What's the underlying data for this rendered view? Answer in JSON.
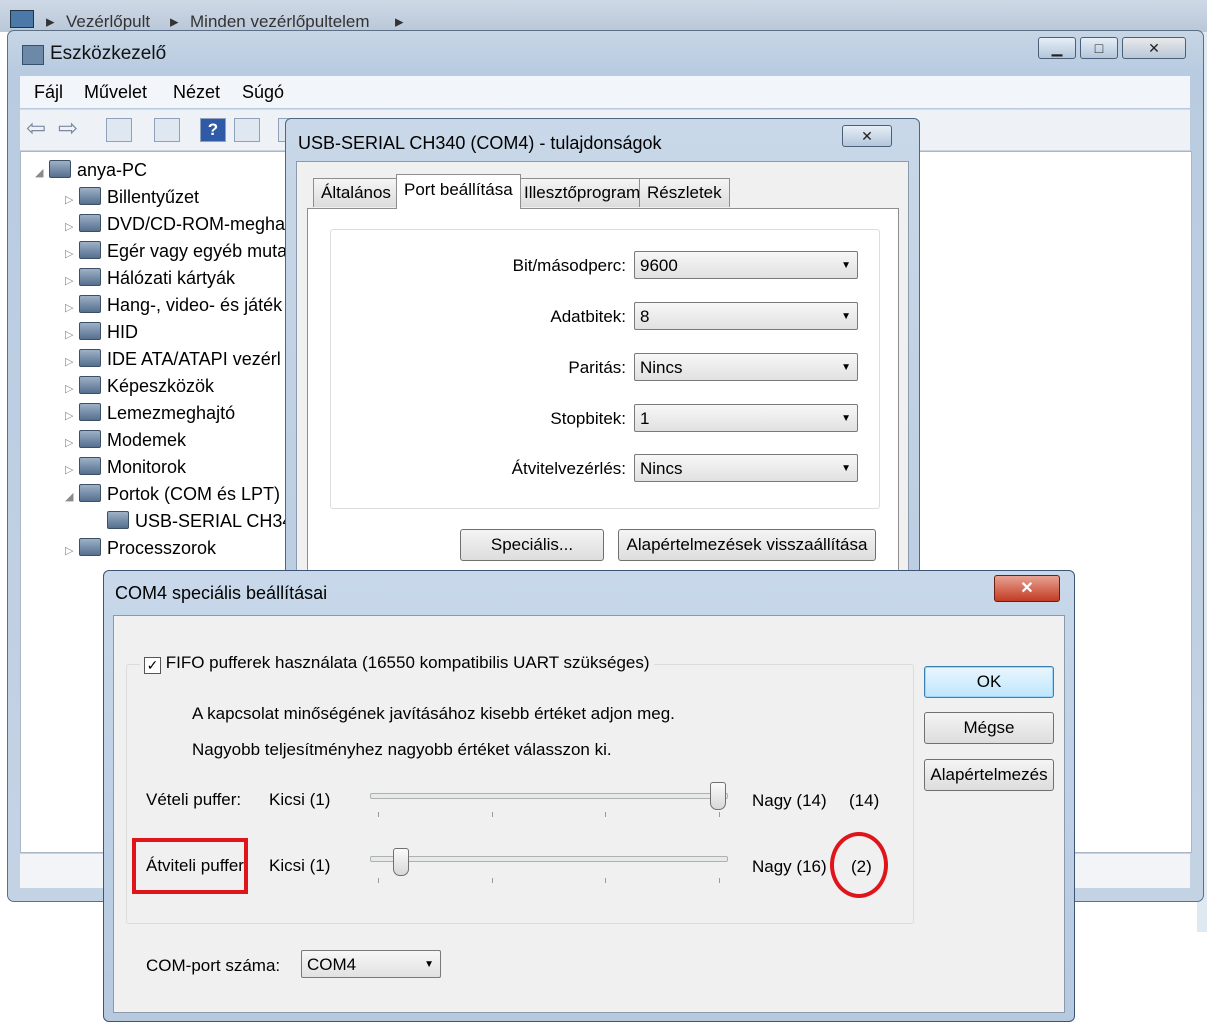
{
  "explorer": {
    "breadcrumb_1": "Vezérlőpult",
    "breadcrumb_2": "Minden vezérlőpultelem",
    "separator": "▸"
  },
  "device_manager": {
    "title": "Eszközkezelő",
    "caption": {
      "minimize": "▁",
      "maximize": "□",
      "close": "✕"
    },
    "menu": [
      "Fájl",
      "Művelet",
      "Nézet",
      "Súgó"
    ],
    "tree": {
      "root": "anya-PC",
      "items": [
        "Billentyűzet",
        "DVD/CD-ROM-megha",
        "Egér vagy egyéb muta",
        "Hálózati kártyák",
        "Hang-, video- és játék",
        "HID",
        "IDE ATA/ATAPI vezérl",
        "Képeszközök",
        "Lemezmeghajtó",
        "Modemek",
        "Monitorok",
        "Portok (COM és LPT)",
        "USB-SERIAL CH34",
        "Processzorok"
      ]
    }
  },
  "properties": {
    "title": "USB-SERIAL CH340 (COM4) - tulajdonságok",
    "close": "✕",
    "tabs": [
      "Általános",
      "Port beállítása",
      "Illesztőprogram",
      "Részletek"
    ],
    "active_tab": "Port beállítása",
    "fields": [
      {
        "label": "Bit/másodperc:",
        "value": "9600"
      },
      {
        "label": "Adatbitek:",
        "value": "8"
      },
      {
        "label": "Paritás:",
        "value": "Nincs"
      },
      {
        "label": "Stopbitek:",
        "value": "1"
      },
      {
        "label": "Átvitelvezérlés:",
        "value": "Nincs"
      }
    ],
    "buttons": {
      "advanced": "Speciális...",
      "restore_defaults": "Alapértelmezések visszaállítása"
    }
  },
  "advanced": {
    "title": "COM4 speciális beállításai",
    "close": "✕",
    "fifo_checkbox": {
      "label": "FIFO pufferek használata (16550 kompatibilis UART szükséges)",
      "checked": true,
      "mark": "✓"
    },
    "hint_1": "A kapcsolat minőségének javításához kisebb értéket adjon meg.",
    "hint_2": "Nagyobb teljesítményhez nagyobb értéket válasszon ki.",
    "receive_buffer": {
      "label": "Vételi puffer:",
      "min_label": "Kicsi (1)",
      "max_label": "Nagy (14)",
      "current": "(14)",
      "min": 1,
      "max": 14,
      "value": 14
    },
    "transmit_buffer": {
      "label": "Átviteli puffer:",
      "min_label": "Kicsi (1)",
      "max_label": "Nagy (16)",
      "current": "(2)",
      "min": 1,
      "max": 16,
      "value": 2
    },
    "com_port": {
      "label": "COM-port száma:",
      "value": "COM4"
    },
    "buttons": {
      "ok": "OK",
      "cancel": "Mégse",
      "defaults": "Alapértelmezés"
    },
    "highlight_color": "#e0141b"
  }
}
